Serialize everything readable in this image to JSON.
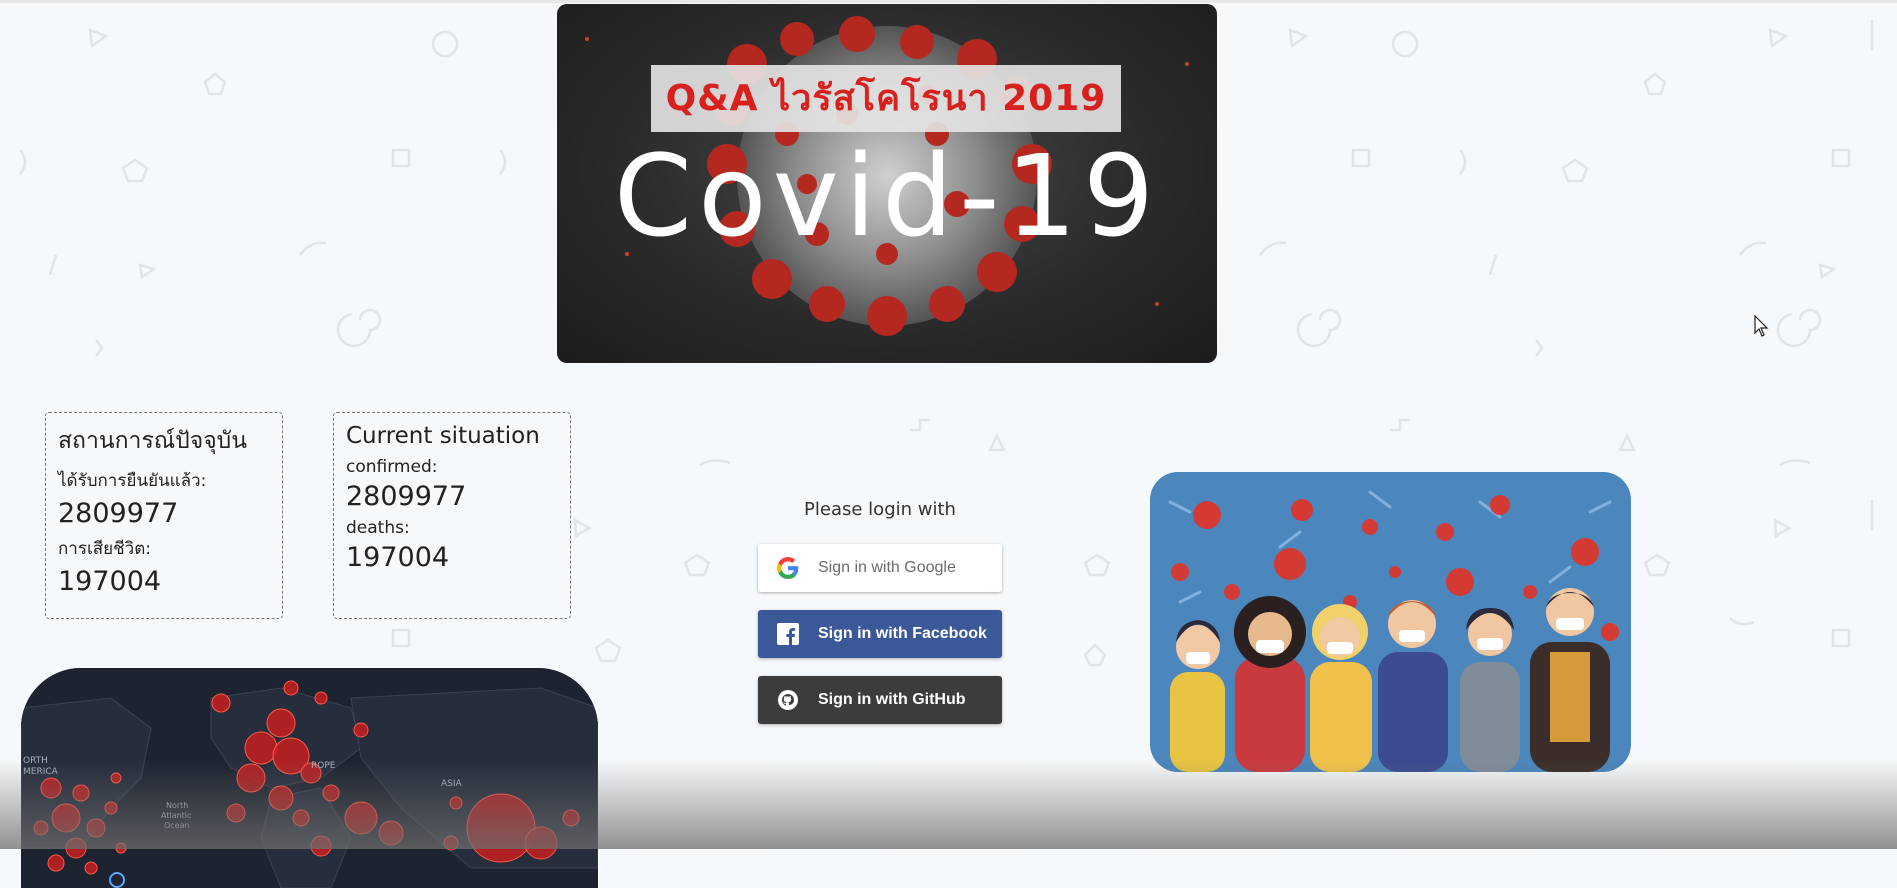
{
  "banner": {
    "tag": "Q&A  ไวรัสโคโรนา 2019",
    "title": "Covid-19"
  },
  "stats_th": {
    "title": "สถานการณ์ปัจจุบัน",
    "confirmed_label": "ได้รับการยืนยันแล้ว:",
    "confirmed_value": "2809977",
    "deaths_label": "การเสียชีวิต:",
    "deaths_value": "197004"
  },
  "stats_en": {
    "title": "Current situation",
    "confirmed_label": "confirmed:",
    "confirmed_value": "2809977",
    "deaths_label": "deaths:",
    "deaths_value": "197004"
  },
  "login": {
    "prompt": "Please login with",
    "google_label": "Sign in with Google",
    "facebook_label": "Sign in with Facebook",
    "github_label": "Sign in with GitHub"
  },
  "map": {
    "label_north_america": "ORTH\nMERICA",
    "label_europe": "ROPE",
    "label_ocean": "North\nAtlantic\nOcean",
    "label_asia": "ASIA"
  },
  "colors": {
    "facebook": "#3b5998",
    "github": "#3c3c3c",
    "virus_red": "#d8201c"
  }
}
